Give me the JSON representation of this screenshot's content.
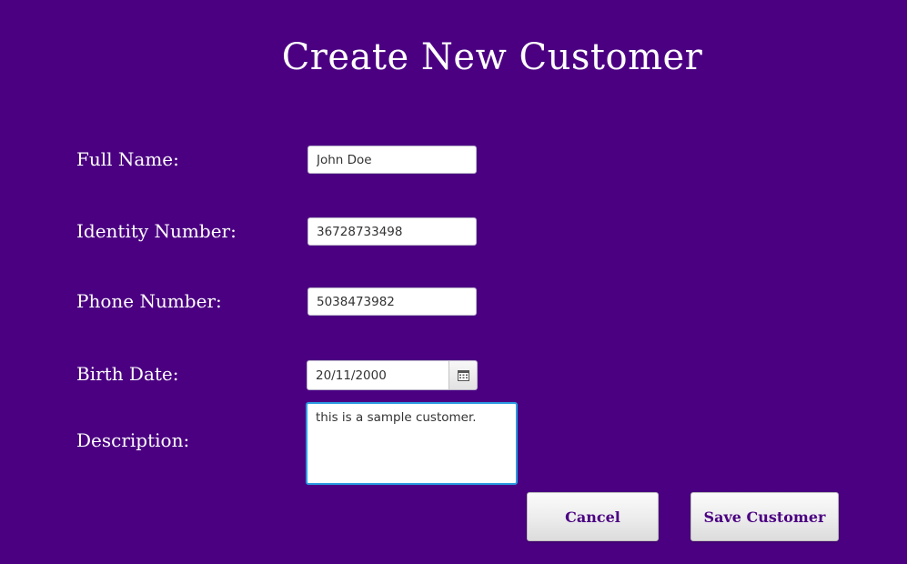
{
  "page": {
    "title": "Create New Customer",
    "background_color": "#4b0082"
  },
  "form": {
    "full_name": {
      "label": "Full Name:",
      "value": "John Doe"
    },
    "identity_number": {
      "label": "Identity Number:",
      "value": "36728733498"
    },
    "phone_number": {
      "label": "Phone Number:",
      "value": "5038473982"
    },
    "birth_date": {
      "label": "Birth Date:",
      "value": "20/11/2000",
      "icon": "calendar-icon"
    },
    "description": {
      "label": "Description:",
      "value": "this is a sample customer."
    }
  },
  "actions": {
    "cancel_label": "Cancel",
    "save_label": "Save Customer",
    "accent_color": "#4b0082"
  }
}
